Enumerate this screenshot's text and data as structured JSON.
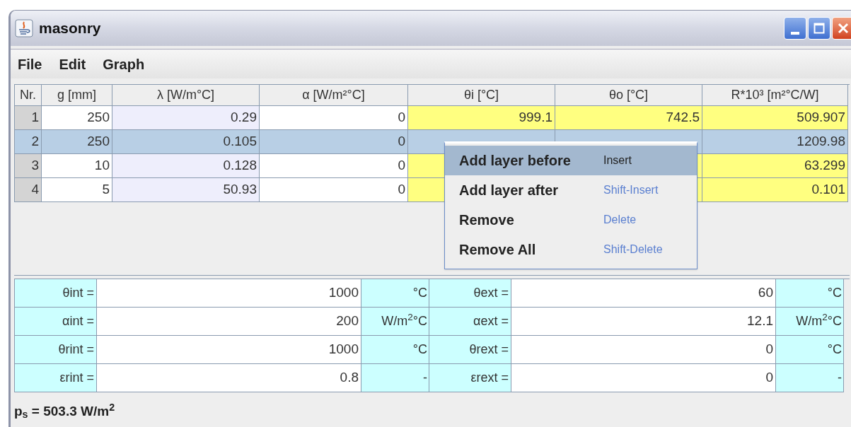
{
  "window": {
    "title": "masonry"
  },
  "menu": [
    "File",
    "Edit",
    "Graph"
  ],
  "table": {
    "columns": [
      {
        "label": "Nr.",
        "kind": "index"
      },
      {
        "label": "g [mm]",
        "kind": "input"
      },
      {
        "label": "λ [W/m°C]",
        "kind": "tinted"
      },
      {
        "label": "α [W/m²°C]",
        "kind": "input"
      },
      {
        "label": "θi [°C]",
        "kind": "result"
      },
      {
        "label": "θo [°C]",
        "kind": "result"
      },
      {
        "label": "R*10³ [m²°C/W]",
        "kind": "result"
      }
    ],
    "rows": [
      {
        "selected": false,
        "cells": [
          "1",
          "250",
          "0.29",
          "0",
          "999.1",
          "742.5",
          "509.907"
        ]
      },
      {
        "selected": true,
        "cells": [
          "2",
          "250",
          "0.105",
          "0",
          null,
          null,
          "1209.98"
        ]
      },
      {
        "selected": false,
        "cells": [
          "3",
          "10",
          "0.128",
          "0",
          null,
          null,
          "63.299"
        ]
      },
      {
        "selected": false,
        "cells": [
          "4",
          "5",
          "50.93",
          "0",
          null,
          null,
          "0.101"
        ]
      }
    ]
  },
  "context_menu": {
    "items": [
      {
        "label": "Add layer before",
        "shortcut": "Insert",
        "selected": true
      },
      {
        "label": "Add layer after",
        "shortcut": "Shift-Insert",
        "selected": false
      },
      {
        "label": "Remove",
        "shortcut": "Delete",
        "selected": false
      },
      {
        "label": "Remove All",
        "shortcut": "Shift-Delete",
        "selected": false
      }
    ]
  },
  "parameters": [
    {
      "left": {
        "label": "θint =",
        "value": "1000",
        "unit": "°C"
      },
      "right": {
        "label": "θext =",
        "value": "60",
        "unit": "°C"
      }
    },
    {
      "left": {
        "label": "αint =",
        "value": "200",
        "unit": "W/m$^{2}$°C"
      },
      "right": {
        "label": "αext =",
        "value": "12.1",
        "unit": "W/m$^{2}$°C"
      }
    },
    {
      "left": {
        "label": "θrint =",
        "value": "1000",
        "unit": "°C"
      },
      "right": {
        "label": "θrext =",
        "value": "0",
        "unit": "°C"
      }
    },
    {
      "left": {
        "label": "εrint =",
        "value": "0.8",
        "unit": "-"
      },
      "right": {
        "label": "εrext =",
        "value": "0",
        "unit": "-"
      }
    }
  ],
  "status": "p$_{s}$ = 503.3 W/m$^{2}$"
}
